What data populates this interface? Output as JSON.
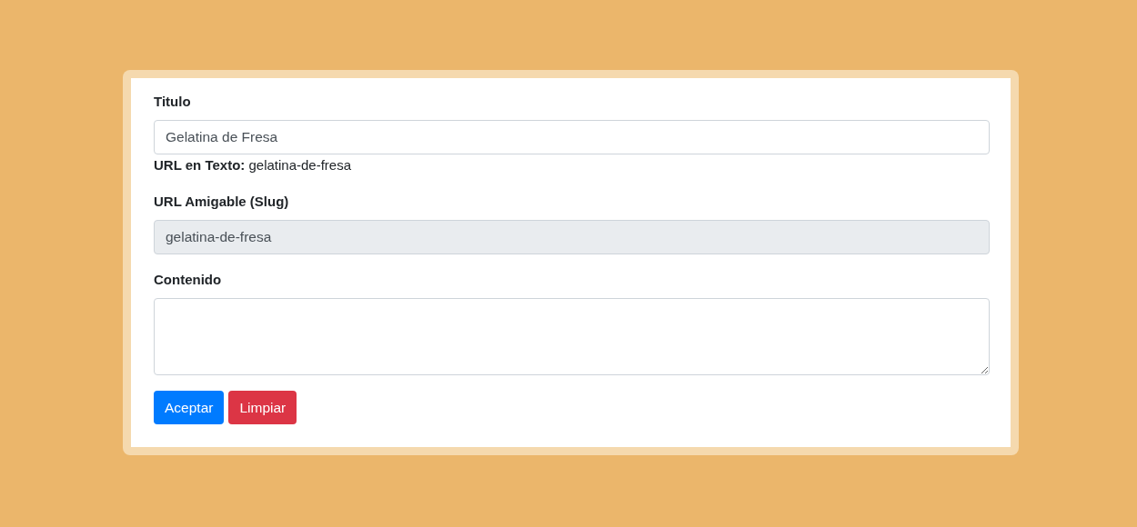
{
  "form": {
    "fields": [
      {
        "kind": "input",
        "label": "Titulo",
        "value": "Gelatina de Fresa",
        "readonly": false,
        "note": "**URL en Texto:** gelatina-de-fresa"
      },
      {
        "kind": "input",
        "label": "URL Amigable (Slug)",
        "value": "gelatina-de-fresa",
        "readonly": true
      },
      {
        "kind": "textarea",
        "label": "Contenido",
        "readonly": false
      }
    ],
    "buttons": [
      {
        "label": "Aceptar",
        "kind": "primary"
      },
      {
        "label": "Limpiar",
        "kind": "danger"
      }
    ]
  }
}
